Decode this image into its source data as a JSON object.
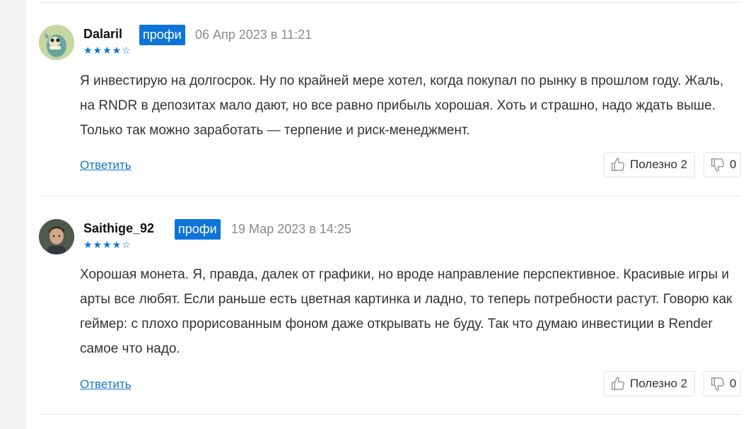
{
  "comments": [
    {
      "author": "Dalaril",
      "badge": "профи",
      "date": "06 Апр 2023 в 11:21",
      "rating": 4,
      "stars_filled": "★★★★",
      "stars_empty": "☆",
      "text": "Я инвестирую на долгосрок. Ну по крайней мере хотел, когда покупал по рынку в прошлом году. Жаль, на RNDR в депозитах мало дают, но все равно прибыль хорошая. Хоть и страшно, надо ждать выше. Только так можно заработать — терпение и риск-менеджмент.",
      "reply_label": "Ответить",
      "useful_label": "Полезно 2",
      "dislike_count": "0"
    },
    {
      "author": "Saithige_92",
      "badge": "профи",
      "date": "19 Мар 2023 в 14:25",
      "rating": 4,
      "stars_filled": "★★★★",
      "stars_empty": "☆",
      "text": "Хорошая монета. Я, правда, далек от графики, но вроде направление перспективное. Красивые игры и арты все любят. Если раньше есть цветная картинка и ладно, то теперь потребности растут. Говорю как геймер: с плохо прорисованным фоном даже открывать не буду. Так что думаю инвестиции в Render самое что надо.",
      "reply_label": "Ответить",
      "useful_label": "Полезно 2",
      "dislike_count": "0"
    }
  ],
  "icons": {
    "like": "thumb-up-icon",
    "dislike": "thumb-down-icon"
  },
  "colors": {
    "accent": "#0d74d8",
    "link": "#1a73c8",
    "date": "#8a8a8a"
  }
}
